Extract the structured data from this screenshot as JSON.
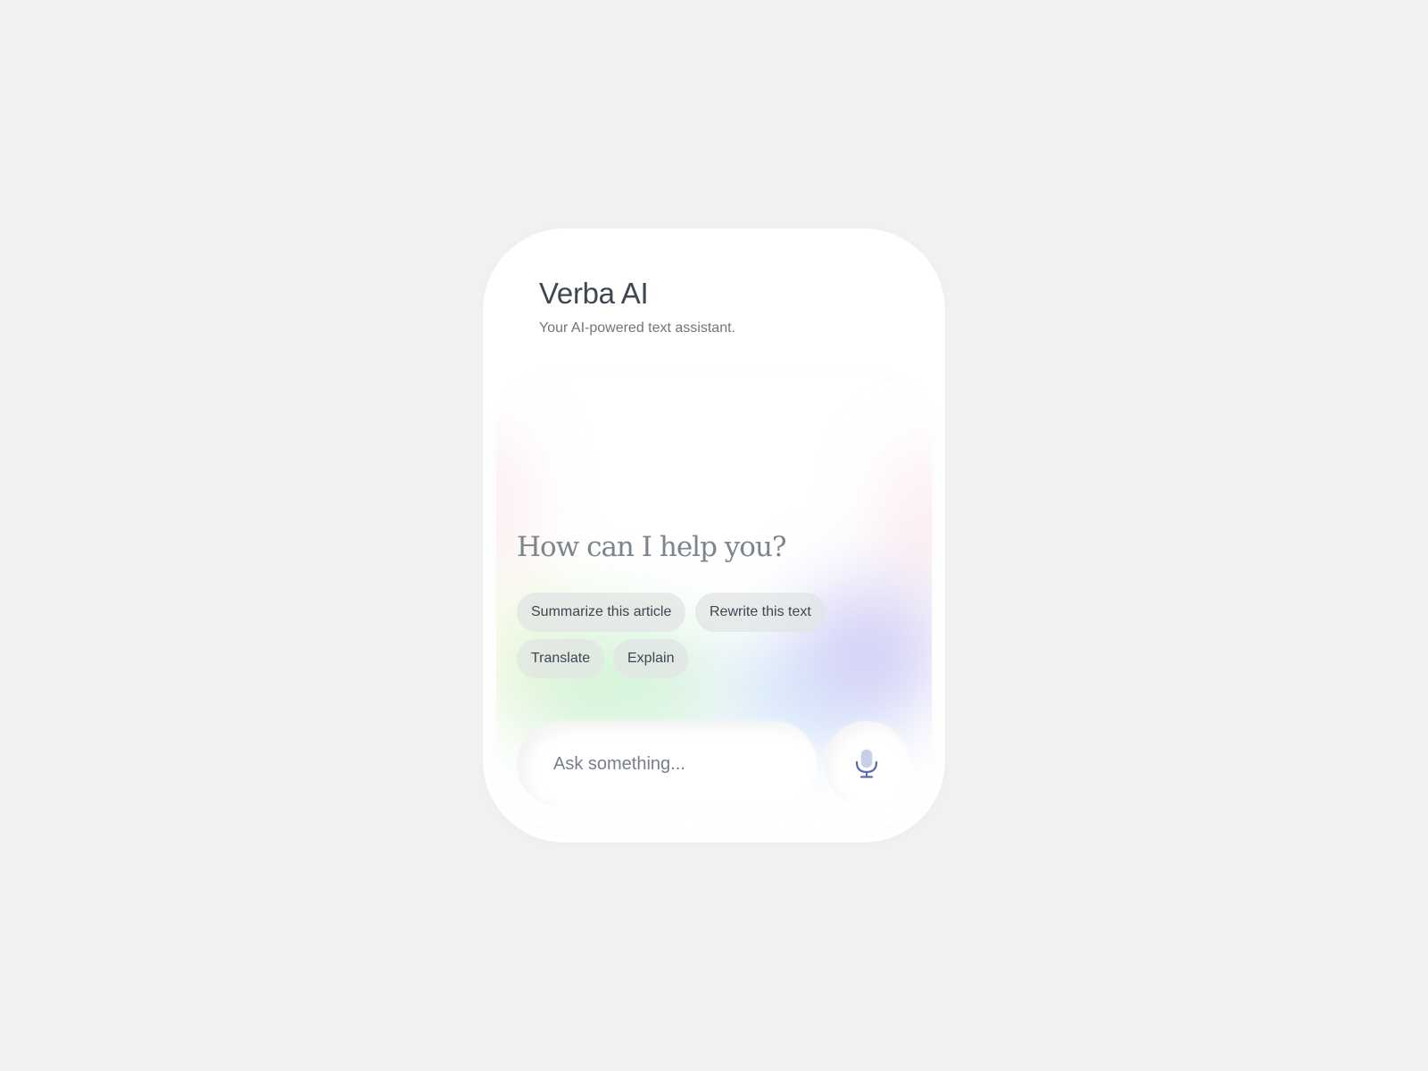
{
  "app": {
    "title": "Verba AI",
    "subtitle": "Your AI-powered text assistant."
  },
  "prompt": {
    "headline": "How can I help you?"
  },
  "suggestions": [
    {
      "label": "Summarize this article"
    },
    {
      "label": "Rewrite this text"
    },
    {
      "label": "Translate"
    },
    {
      "label": "Explain"
    }
  ],
  "input": {
    "placeholder": "Ask something...",
    "value": ""
  },
  "mic": {
    "icon": "microphone-icon",
    "color": "#5a6ab8"
  },
  "colors": {
    "background": "#f1f1f1",
    "card": "#ffffff",
    "title_text": "#3e4650",
    "headline_text": "#7d858c",
    "chip_background": "#e1e6e4"
  }
}
